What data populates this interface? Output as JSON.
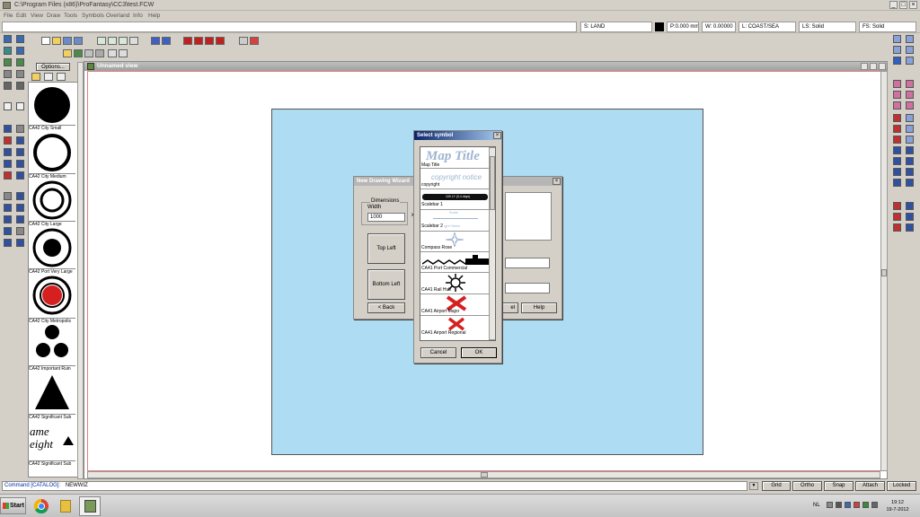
{
  "window": {
    "title": "C:\\Program Files (x86)\\ProFantasy\\CC3\\test.FCW"
  },
  "menu": [
    "File",
    "Edit",
    "View",
    "Draw",
    "Tools",
    "Symbols",
    "Overland",
    "Info",
    "Help"
  ],
  "status": {
    "sheet": "S: LAND",
    "pen": "P:0.000 mm",
    "width": "W: 0.00000",
    "layer": "L: COAST/SEA",
    "line_style": "LS: Solid",
    "fill_style": "FS: Solid"
  },
  "catalog": {
    "options_label": "Options...",
    "items": [
      "CA42 City Small",
      "CA42 City Medium",
      "CA42 City Large",
      "CA42 Port Very Large",
      "CA42 City Metropolis",
      "CA42 Important Ruin",
      "CA42 Significant Sub",
      "CA42 Significant Sub"
    ],
    "partial_symbol_text_1": "ame",
    "partial_symbol_text_2": "eight"
  },
  "view": {
    "title": "Unnamed view"
  },
  "wizard": {
    "title": "New Drawing Wizard",
    "group_label": "Dimensions",
    "width_label": "Width",
    "width_value": "1000",
    "top_left": "Top Left",
    "bottom_left": "Bottom Left",
    "back": "< Back",
    "cancel_partial": "el",
    "help": "Help"
  },
  "select_symbol": {
    "title": "Select symbol",
    "items": [
      {
        "label": "Map Title",
        "preview_text": "Map Title"
      },
      {
        "label": "copyright",
        "preview_text": "copyright notice"
      },
      {
        "label": "Scalebar 1",
        "preview_text": "100 LY (3.4 days)"
      },
      {
        "label": "Scalebar 2",
        "preview_text": "Scale",
        "extra": "ight Years"
      },
      {
        "label": "Compass Rose",
        "preview_text": ""
      },
      {
        "label": "CA41 Port Commercial",
        "preview_text": ""
      },
      {
        "label": "CA41 Rail Hub",
        "preview_text": ""
      },
      {
        "label": "CA41 Airport Major",
        "preview_text": ""
      },
      {
        "label": "CA41 Airport Regional",
        "preview_text": ""
      }
    ],
    "cancel": "Cancel",
    "ok": "OK"
  },
  "command": {
    "prompt": "Command [CATALOG]:",
    "value": "NEWWIZ",
    "buttons": [
      "Grid",
      "Ortho",
      "Snap",
      "Attach",
      "Locked"
    ]
  },
  "taskbar": {
    "start": "Start",
    "lang": "NL",
    "time": "19:12",
    "date": "19-7-2012"
  },
  "colors": {
    "map_background": "#aedcf3",
    "canvas_border": "#e08080",
    "symbol_red": "#d62020"
  }
}
